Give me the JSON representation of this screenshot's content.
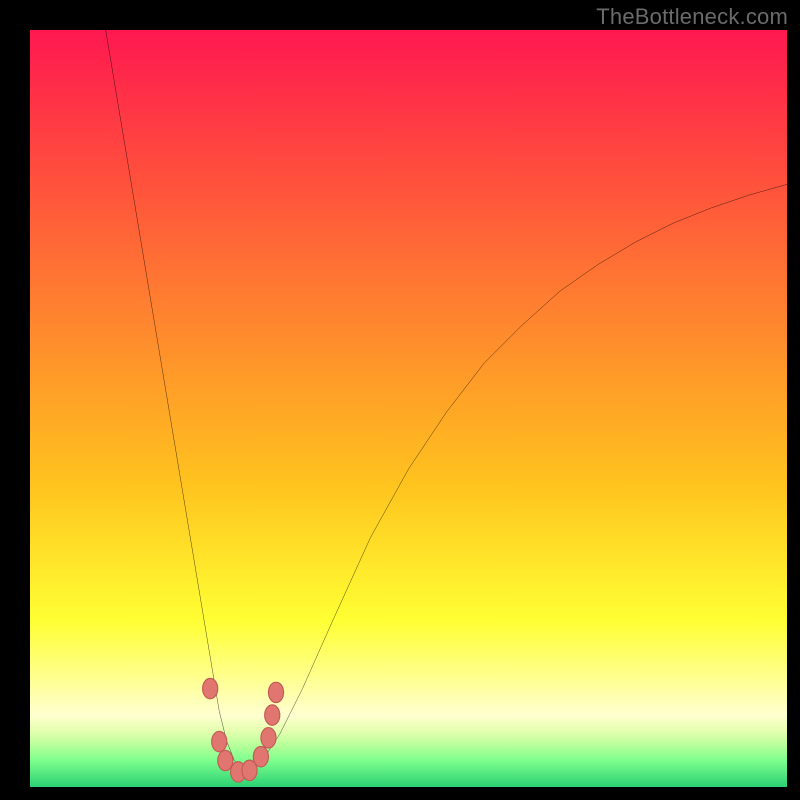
{
  "watermark": "TheBottleneck.com",
  "colors": {
    "black": "#000000",
    "curve": "#000000",
    "marker_fill": "#e0766f",
    "marker_stroke": "#c25a53",
    "gradient_stops": [
      {
        "offset": 0.0,
        "color": "#ff1850"
      },
      {
        "offset": 0.18,
        "color": "#ff4b3e"
      },
      {
        "offset": 0.4,
        "color": "#ff8a2d"
      },
      {
        "offset": 0.6,
        "color": "#ffc31e"
      },
      {
        "offset": 0.78,
        "color": "#ffff33"
      },
      {
        "offset": 0.85,
        "color": "#ffff88"
      },
      {
        "offset": 0.905,
        "color": "#ffffd0"
      },
      {
        "offset": 0.925,
        "color": "#e6ffb0"
      },
      {
        "offset": 0.945,
        "color": "#b6ff9a"
      },
      {
        "offset": 0.965,
        "color": "#7dff8d"
      },
      {
        "offset": 1.0,
        "color": "#2bd074"
      }
    ]
  },
  "chart_data": {
    "type": "line",
    "title": "",
    "xlabel": "",
    "ylabel": "",
    "xlim": [
      0,
      100
    ],
    "ylim": [
      0,
      100
    ],
    "grid": false,
    "legend": false,
    "series": [
      {
        "name": "bottleneck-curve",
        "x": [
          10,
          12,
          14,
          16,
          18,
          20,
          22,
          24,
          25,
          26,
          27,
          28,
          29,
          30,
          31,
          33,
          36,
          40,
          45,
          50,
          55,
          60,
          65,
          70,
          75,
          80,
          85,
          90,
          95,
          100
        ],
        "y": [
          100,
          88,
          76,
          64,
          52,
          40,
          28,
          16,
          10,
          6,
          3.5,
          2.5,
          2.5,
          3,
          4,
          7,
          13,
          22,
          33,
          42,
          49.5,
          56,
          61,
          65.5,
          69,
          72,
          74.5,
          76.5,
          78.2,
          79.6
        ]
      }
    ],
    "markers": [
      {
        "x": 23.8,
        "y": 13.0
      },
      {
        "x": 25.0,
        "y": 6.0
      },
      {
        "x": 25.8,
        "y": 3.5
      },
      {
        "x": 27.5,
        "y": 2.0
      },
      {
        "x": 29.0,
        "y": 2.2
      },
      {
        "x": 30.5,
        "y": 4.0
      },
      {
        "x": 31.5,
        "y": 6.5
      },
      {
        "x": 32.0,
        "y": 9.5
      },
      {
        "x": 32.5,
        "y": 12.5
      }
    ],
    "annotations": []
  }
}
